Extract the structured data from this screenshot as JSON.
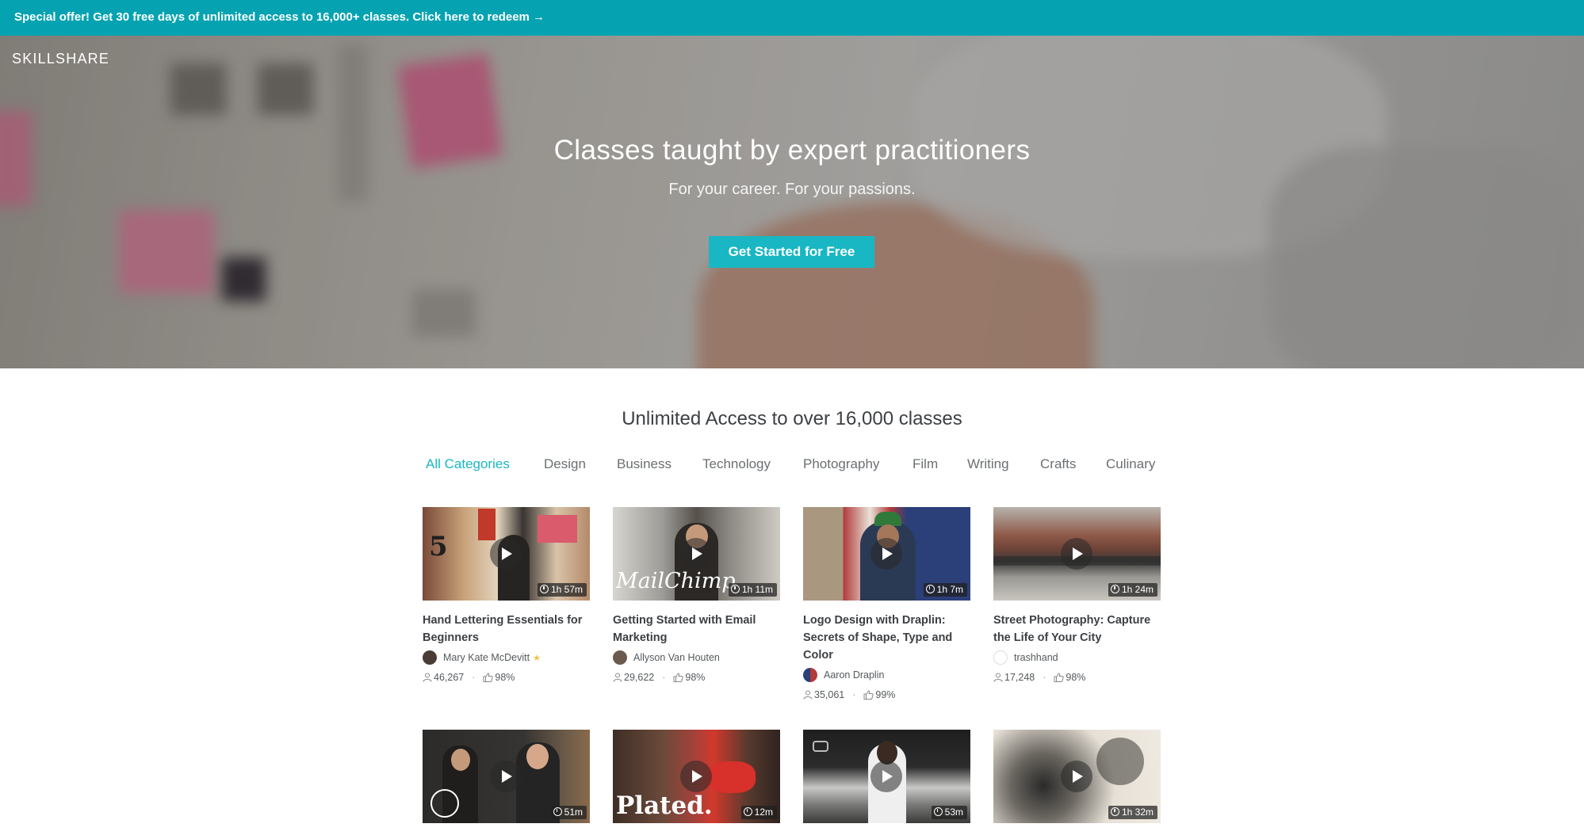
{
  "promo": {
    "text": "Special offer! Get 30 free days of unlimited access to 16,000+ classes. Click here to redeem →"
  },
  "brand": "SKILLSHARE",
  "hero": {
    "title": "Classes taught by expert practitioners",
    "subtitle": "For your career. For your passions.",
    "cta_label": "Get Started for Free"
  },
  "section_title": "Unlimited Access to over 16,000 classes",
  "categories": [
    "All Categories",
    "Design",
    "Business",
    "Technology",
    "Photography",
    "Film",
    "Writing",
    "Crafts",
    "Culinary"
  ],
  "active_category": "All Categories",
  "colors": {
    "teal": "#05a3b1",
    "accent": "#19b7c3",
    "star": "#f5c342"
  },
  "classes": [
    {
      "title": "Hand Lettering Essentials for Beginners",
      "duration": "1h 57m",
      "author": "Mary Kate McDevitt",
      "featured": true,
      "students": "46,267",
      "rating": "98%"
    },
    {
      "title": "Getting Started with Email Marketing",
      "duration": "1h 11m",
      "author": "Allyson Van Houten",
      "students": "29,622",
      "rating": "98%",
      "overlay": "MailChimp"
    },
    {
      "title": "Logo Design with Draplin: Secrets of Shape, Type and Color",
      "duration": "1h 7m",
      "author": "Aaron Draplin",
      "students": "35,061",
      "rating": "99%"
    },
    {
      "title": "Street Photography: Capture the Life of Your City",
      "duration": "1h 24m",
      "author": "trashhand",
      "students": "17,248",
      "rating": "98%"
    },
    {
      "duration": "51m"
    },
    {
      "duration": "12m",
      "overlay": "Plated."
    },
    {
      "duration": "53m"
    },
    {
      "duration": "1h 32m"
    }
  ]
}
